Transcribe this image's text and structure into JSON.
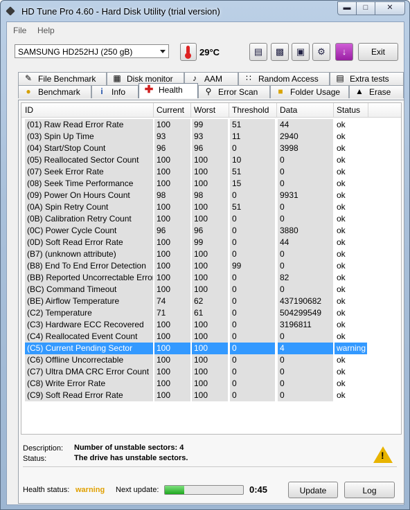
{
  "window": {
    "title": "HD Tune Pro 4.60 - Hard Disk Utility (trial version)"
  },
  "menu": [
    {
      "label": "File"
    },
    {
      "label": "Help"
    }
  ],
  "toolbar": {
    "drive": "SAMSUNG HD252HJ (250 gB)",
    "temperature": "29°C",
    "exit_label": "Exit",
    "buttons": [
      "copy-text-icon",
      "copy-screenshot-icon",
      "save-icon",
      "options-icon",
      "download-icon"
    ]
  },
  "tabs_top": [
    "File Benchmark",
    "Disk monitor",
    "AAM",
    "Random Access",
    "Extra tests"
  ],
  "tabs_bottom": [
    "Benchmark",
    "Info",
    "Health",
    "Error Scan",
    "Folder Usage",
    "Erase"
  ],
  "active_tab": "Health",
  "table": {
    "headers": [
      "ID",
      "Current",
      "Worst",
      "Threshold",
      "Data",
      "Status"
    ],
    "rows": [
      [
        "(01) Raw Read Error Rate",
        "100",
        "99",
        "51",
        "44",
        "ok"
      ],
      [
        "(03) Spin Up Time",
        "93",
        "93",
        "11",
        "2940",
        "ok"
      ],
      [
        "(04) Start/Stop Count",
        "96",
        "96",
        "0",
        "3998",
        "ok"
      ],
      [
        "(05) Reallocated Sector Count",
        "100",
        "100",
        "10",
        "0",
        "ok"
      ],
      [
        "(07) Seek Error Rate",
        "100",
        "100",
        "51",
        "0",
        "ok"
      ],
      [
        "(08) Seek Time Performance",
        "100",
        "100",
        "15",
        "0",
        "ok"
      ],
      [
        "(09) Power On Hours Count",
        "98",
        "98",
        "0",
        "9931",
        "ok"
      ],
      [
        "(0A) Spin Retry Count",
        "100",
        "100",
        "51",
        "0",
        "ok"
      ],
      [
        "(0B) Calibration Retry Count",
        "100",
        "100",
        "0",
        "0",
        "ok"
      ],
      [
        "(0C) Power Cycle Count",
        "96",
        "96",
        "0",
        "3880",
        "ok"
      ],
      [
        "(0D) Soft Read Error Rate",
        "100",
        "99",
        "0",
        "44",
        "ok"
      ],
      [
        "(B7) (unknown attribute)",
        "100",
        "100",
        "0",
        "0",
        "ok"
      ],
      [
        "(B8) End To End Error Detection",
        "100",
        "100",
        "99",
        "0",
        "ok"
      ],
      [
        "(BB) Reported Uncorrectable Errors",
        "100",
        "100",
        "0",
        "82",
        "ok"
      ],
      [
        "(BC) Command Timeout",
        "100",
        "100",
        "0",
        "0",
        "ok"
      ],
      [
        "(BE) Airflow Temperature",
        "74",
        "62",
        "0",
        "437190682",
        "ok"
      ],
      [
        "(C2) Temperature",
        "71",
        "61",
        "0",
        "504299549",
        "ok"
      ],
      [
        "(C3) Hardware ECC Recovered",
        "100",
        "100",
        "0",
        "3196811",
        "ok"
      ],
      [
        "(C4) Reallocated Event Count",
        "100",
        "100",
        "0",
        "0",
        "ok"
      ],
      [
        "(C5) Current Pending Sector",
        "100",
        "100",
        "0",
        "4",
        "warning"
      ],
      [
        "(C6) Offline Uncorrectable",
        "100",
        "100",
        "0",
        "0",
        "ok"
      ],
      [
        "(C7) Ultra DMA CRC Error Count",
        "100",
        "100",
        "0",
        "0",
        "ok"
      ],
      [
        "(C8) Write Error Rate",
        "100",
        "100",
        "0",
        "0",
        "ok"
      ],
      [
        "(C9) Soft Read Error Rate",
        "100",
        "100",
        "0",
        "0",
        "ok"
      ]
    ],
    "selected_row": 19
  },
  "details": {
    "description_label": "Description:",
    "description_value": "Number of unstable sectors: 4",
    "status_label": "Status:",
    "status_value": "The drive has unstable sectors."
  },
  "footer": {
    "health_label": "Health status:",
    "health_value": "warning",
    "health_color": "#e0a000",
    "next_update_label": "Next update:",
    "progress_fraction": 0.25,
    "countdown": "0:45",
    "update_label": "Update",
    "log_label": "Log"
  }
}
